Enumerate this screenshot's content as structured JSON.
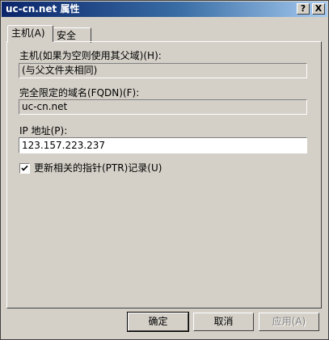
{
  "window": {
    "title": "uc-cn.net 属性",
    "help_label": "?",
    "close_label": "X"
  },
  "tabs": [
    {
      "label": "主机(A)",
      "selected": true
    },
    {
      "label": "安全",
      "selected": false
    }
  ],
  "form": {
    "host_label": "主机(如果为空则使用其父域)(H):",
    "host_value": "(与父文件夹相同)",
    "fqdn_label": "完全限定的域名(FQDN)(F):",
    "fqdn_value": "uc-cn.net",
    "ip_label": "IP 地址(P):",
    "ip_value": "123.157.223.237",
    "ptr_label": "更新相关的指针(PTR)记录(U)",
    "ptr_checked": true
  },
  "buttons": {
    "ok_label": "确定",
    "cancel_label": "取消",
    "apply_label": "应用(A)"
  },
  "colors": {
    "face": "#d4d0c8",
    "title_start": "#0a246a",
    "title_end": "#a6caf0"
  }
}
